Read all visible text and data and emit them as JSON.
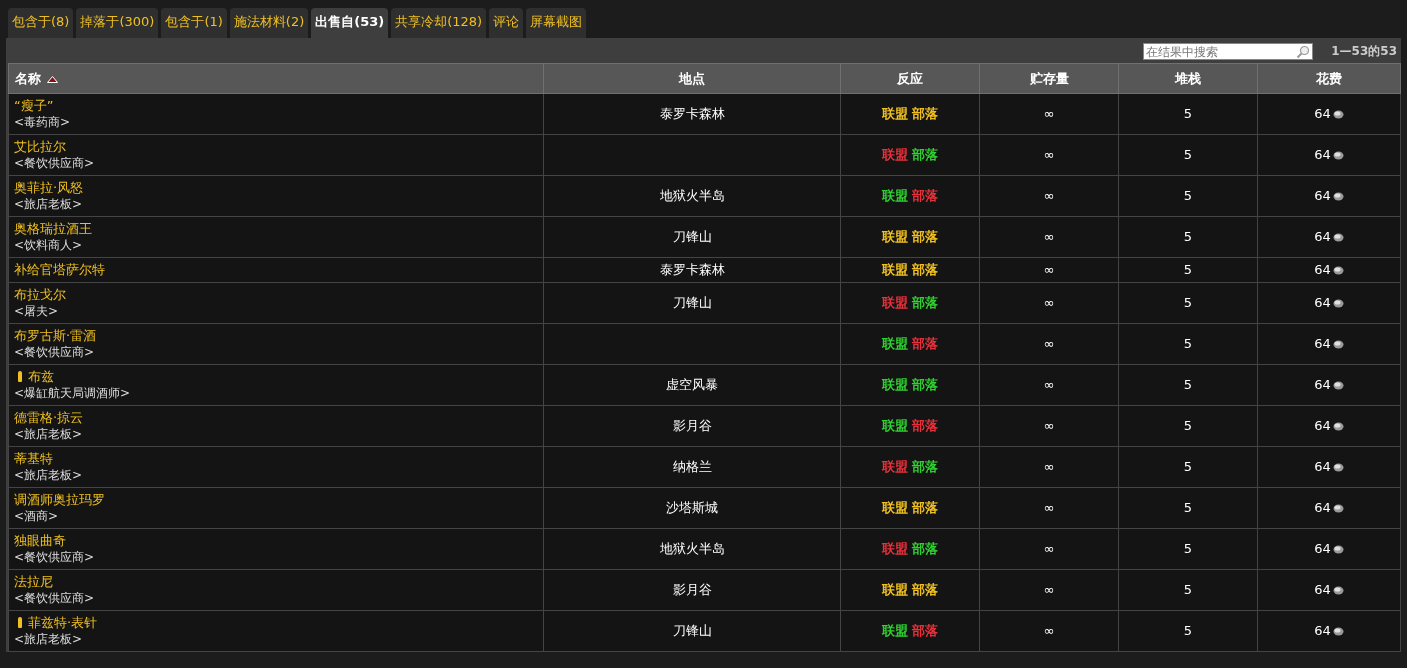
{
  "tabs": [
    {
      "label": "包含于(8)",
      "selected": false
    },
    {
      "label": "掉落于(300)",
      "selected": false
    },
    {
      "label": "包含于(1)",
      "selected": false
    },
    {
      "label": "施法材料(2)",
      "selected": false
    },
    {
      "label": "出售自(53)",
      "selected": true
    },
    {
      "label": "共享冷却(128)",
      "selected": false
    },
    {
      "label": "评论",
      "selected": false
    },
    {
      "label": "屏幕截图",
      "selected": false
    }
  ],
  "search": {
    "placeholder": "在结果中搜索"
  },
  "result_count": "1—53的53",
  "table": {
    "columns": [
      {
        "label": "名称",
        "sorted": true
      },
      {
        "label": "地点",
        "sorted": false
      },
      {
        "label": "反应",
        "sorted": false
      },
      {
        "label": "贮存量",
        "sorted": false
      },
      {
        "label": "堆栈",
        "sorted": false
      },
      {
        "label": "花费",
        "sorted": false
      }
    ],
    "rows": [
      {
        "name": "“瘦子”",
        "title": "<毒药商>",
        "quest": false,
        "location": "泰罗卡森林",
        "alliance": {
          "label": "联盟",
          "color": "#f0c020"
        },
        "horde": {
          "label": "部落",
          "color": "#f0c020"
        },
        "stock": "∞",
        "stack": "5",
        "cost": "64"
      },
      {
        "name": "艾比拉尔",
        "title": "<餐饮供应商>",
        "quest": false,
        "alliance": {
          "label": "联盟",
          "color": "#e8303a"
        },
        "horde": {
          "label": "部落",
          "color": "#30d030"
        },
        "stock": "∞",
        "stack": "5",
        "cost": "64"
      },
      {
        "name": "奥菲拉·风怒",
        "title": "<旅店老板>",
        "quest": false,
        "location": "地狱火半岛",
        "alliance": {
          "label": "联盟",
          "color": "#30d030"
        },
        "horde": {
          "label": "部落",
          "color": "#e8303a"
        },
        "stock": "∞",
        "stack": "5",
        "cost": "64"
      },
      {
        "name": "奥格瑞拉酒王",
        "title": "<饮料商人>",
        "quest": false,
        "location": "刀锋山",
        "alliance": {
          "label": "联盟",
          "color": "#f0c020"
        },
        "horde": {
          "label": "部落",
          "color": "#f0c020"
        },
        "stock": "∞",
        "stack": "5",
        "cost": "64"
      },
      {
        "name": "补给官塔萨尔特",
        "quest": false,
        "location": "泰罗卡森林",
        "alliance": {
          "label": "联盟",
          "color": "#f0c020"
        },
        "horde": {
          "label": "部落",
          "color": "#f0c020"
        },
        "stock": "∞",
        "stack": "5",
        "cost": "64"
      },
      {
        "name": "布拉戈尔",
        "title": "<屠夫>",
        "quest": false,
        "location": "刀锋山",
        "alliance": {
          "label": "联盟",
          "color": "#e8303a"
        },
        "horde": {
          "label": "部落",
          "color": "#30d030"
        },
        "stock": "∞",
        "stack": "5",
        "cost": "64"
      },
      {
        "name": "布罗古斯·雷酒",
        "title": "<餐饮供应商>",
        "quest": false,
        "alliance": {
          "label": "联盟",
          "color": "#30d030"
        },
        "horde": {
          "label": "部落",
          "color": "#e8303a"
        },
        "stock": "∞",
        "stack": "5",
        "cost": "64"
      },
      {
        "name": "布兹",
        "title": "<爆缸航天局调酒师>",
        "quest": true,
        "location": "虚空风暴",
        "alliance": {
          "label": "联盟",
          "color": "#30d030"
        },
        "horde": {
          "label": "部落",
          "color": "#30d030"
        },
        "stock": "∞",
        "stack": "5",
        "cost": "64"
      },
      {
        "name": "德雷格·掠云",
        "title": "<旅店老板>",
        "quest": false,
        "location": "影月谷",
        "alliance": {
          "label": "联盟",
          "color": "#30d030"
        },
        "horde": {
          "label": "部落",
          "color": "#e8303a"
        },
        "stock": "∞",
        "stack": "5",
        "cost": "64"
      },
      {
        "name": "蒂基特",
        "title": "<旅店老板>",
        "quest": false,
        "location": "纳格兰",
        "alliance": {
          "label": "联盟",
          "color": "#e8303a"
        },
        "horde": {
          "label": "部落",
          "color": "#30d030"
        },
        "stock": "∞",
        "stack": "5",
        "cost": "64"
      },
      {
        "name": "调酒师奥拉玛罗",
        "title": "<酒商>",
        "quest": false,
        "location": "沙塔斯城",
        "alliance": {
          "label": "联盟",
          "color": "#f0c020"
        },
        "horde": {
          "label": "部落",
          "color": "#f0c020"
        },
        "stock": "∞",
        "stack": "5",
        "cost": "64"
      },
      {
        "name": "独眼曲奇",
        "title": "<餐饮供应商>",
        "quest": false,
        "location": "地狱火半岛",
        "alliance": {
          "label": "联盟",
          "color": "#e8303a"
        },
        "horde": {
          "label": "部落",
          "color": "#30d030"
        },
        "stock": "∞",
        "stack": "5",
        "cost": "64"
      },
      {
        "name": "法拉尼",
        "title": "<餐饮供应商>",
        "quest": false,
        "location": "影月谷",
        "alliance": {
          "label": "联盟",
          "color": "#f0c020"
        },
        "horde": {
          "label": "部落",
          "color": "#f0c020"
        },
        "stock": "∞",
        "stack": "5",
        "cost": "64"
      },
      {
        "name": "菲兹特·表针",
        "title": "<旅店老板>",
        "quest": true,
        "location": "刀锋山",
        "alliance": {
          "label": "联盟",
          "color": "#30d030"
        },
        "horde": {
          "label": "部落",
          "color": "#e8303a"
        },
        "stock": "∞",
        "stack": "5",
        "cost": "64"
      }
    ]
  }
}
